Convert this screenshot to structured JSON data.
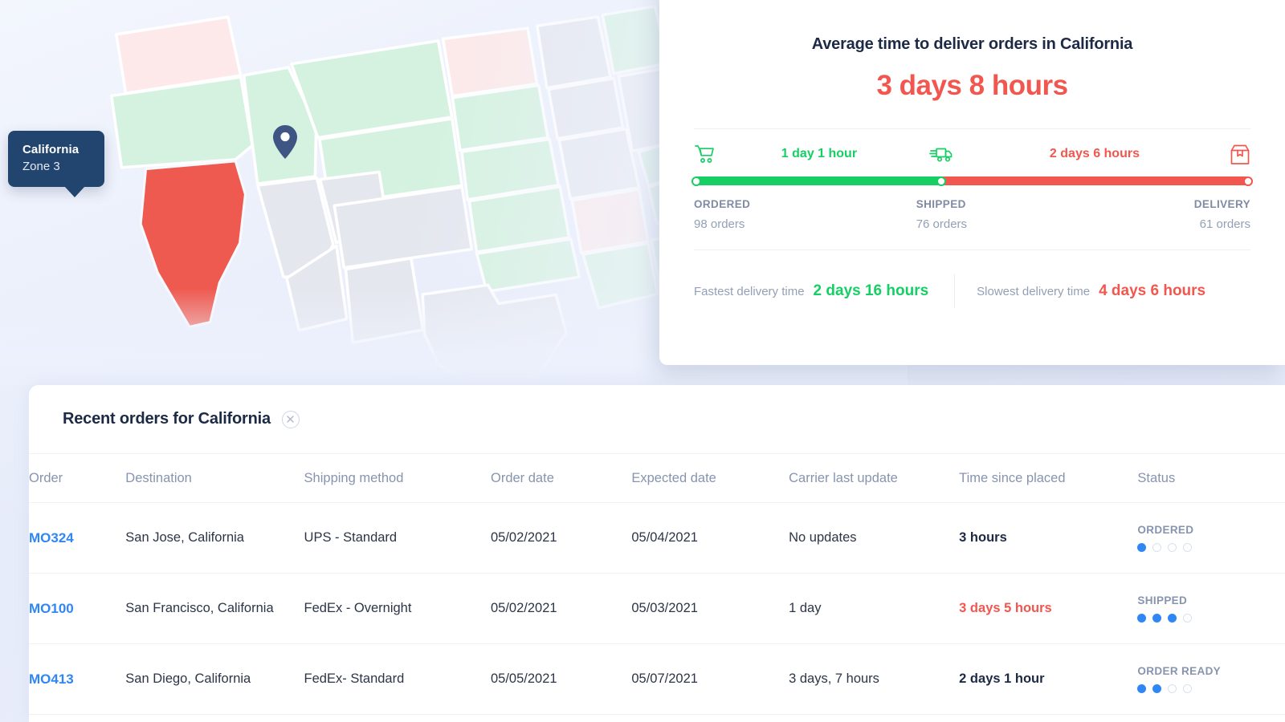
{
  "map": {
    "tooltip": {
      "title": "California",
      "subtitle": "Zone 3"
    },
    "pin_name": "location-pin"
  },
  "delivery_card": {
    "title": "Average time to deliver orders in California",
    "average_time": "3 days 8 hours",
    "timeline": {
      "segments": [
        {
          "label": "1 day 1 hour",
          "color": "#15cf64"
        },
        {
          "label": "2 days 6 hours",
          "color": "#f1574f"
        }
      ],
      "split_percent": 44.5,
      "steps": [
        {
          "label": "ORDERED",
          "count": "98 orders"
        },
        {
          "label": "SHIPPED",
          "count": "76 orders"
        },
        {
          "label": "DELIVERY",
          "count": "61 orders"
        }
      ],
      "icons": [
        "shopping-cart-icon",
        "delivery-truck-icon",
        "package-bag-icon"
      ]
    },
    "footer": {
      "fastest_label": "Fastest delivery time",
      "fastest_value": "2 days 16 hours",
      "slowest_label": "Slowest delivery time",
      "slowest_value": "4 days 6 hours"
    }
  },
  "orders": {
    "title": "Recent orders for California",
    "columns": [
      "Order",
      "Destination",
      "Shipping method",
      "Order date",
      "Expected date",
      "Carrier last update",
      "Time since placed",
      "Status"
    ],
    "rows": [
      {
        "order": "MO324",
        "destination": "San Jose, California",
        "shipping_method": "UPS - Standard",
        "order_date": "05/02/2021",
        "expected_date": "05/04/2021",
        "carrier_last_update": "No updates",
        "carrier_muted": true,
        "time_since_placed": "3 hours",
        "time_style": "bold",
        "status": "ORDERED",
        "status_steps": 1
      },
      {
        "order": "MO100",
        "destination": "San Francisco, California",
        "shipping_method": "FedEx - Overnight",
        "order_date": "05/02/2021",
        "expected_date": "05/03/2021",
        "carrier_last_update": "1 day",
        "carrier_muted": false,
        "time_since_placed": "3 days 5 hours",
        "time_style": "danger",
        "status": "SHIPPED",
        "status_steps": 3
      },
      {
        "order": "MO413",
        "destination": "San Diego, California",
        "shipping_method": "FedEx- Standard",
        "order_date": "05/05/2021",
        "expected_date": "05/07/2021",
        "carrier_last_update": "3 days, 7 hours",
        "carrier_muted": false,
        "time_since_placed": "2 days 1 hour",
        "time_style": "bold",
        "status": "ORDER READY",
        "status_steps": 2
      }
    ]
  },
  "colors": {
    "accent_blue": "#2f86f5",
    "green": "#15cf64",
    "red": "#f1574f",
    "navy": "#21456f",
    "map_green": "#d4f2df",
    "map_gray": "#e4e7ee",
    "map_pink": "#fde9e9",
    "map_red": "#ee5a50",
    "background": "#e9eefb"
  }
}
